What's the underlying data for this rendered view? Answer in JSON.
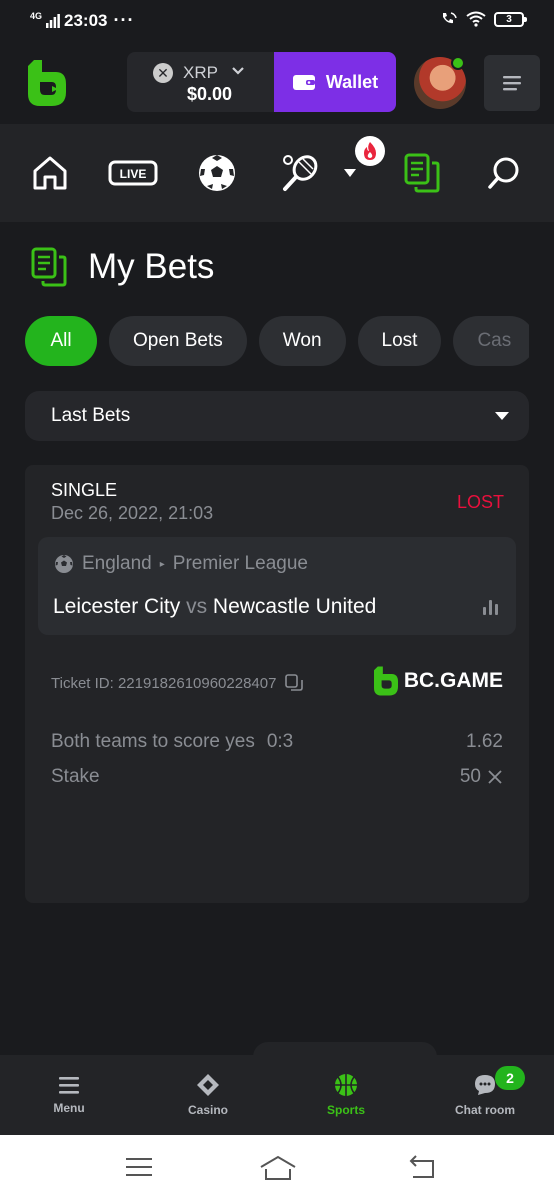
{
  "status_bar": {
    "network": "4G",
    "time": "23:03",
    "dots": "···",
    "battery": "3"
  },
  "header": {
    "currency": "XRP",
    "currency_icon": "x-coin-icon",
    "balance": "$0.00",
    "wallet_label": "Wallet"
  },
  "nav": {
    "icons": [
      "home-icon",
      "live-icon",
      "soccer-ball-icon",
      "tennis-icon",
      "more-dropdown-icon",
      "fire-icon",
      "my-bets-icon",
      "search-icon"
    ],
    "live_label": "LIVE"
  },
  "page": {
    "title": "My Bets"
  },
  "filters": [
    {
      "label": "All",
      "active": true
    },
    {
      "label": "Open Bets"
    },
    {
      "label": "Won"
    },
    {
      "label": "Lost"
    },
    {
      "label": "Cas"
    }
  ],
  "dropdown": {
    "selected": "Last Bets"
  },
  "bet": {
    "type": "SINGLE",
    "date": "Dec 26, 2022, 21:03",
    "status": "LOST",
    "country": "England",
    "league": "Premier League",
    "home": "Leicester City",
    "vs": "vs",
    "away": "Newcastle United",
    "ticket": "Ticket ID: 2219182610960228407",
    "brand": "BC.GAME",
    "selection": "Both teams to score yes",
    "score": "0:3",
    "odds": "1.62",
    "stake_label": "Stake",
    "stake_value": "50"
  },
  "tabbar": [
    {
      "label": "Menu",
      "icon": "menu-icon"
    },
    {
      "label": "Casino",
      "icon": "casino-icon"
    },
    {
      "label": "Sports",
      "icon": "basketball-icon",
      "active": true
    },
    {
      "label": "Chat room",
      "icon": "chat-icon",
      "badge": "2"
    }
  ],
  "colors": {
    "accent": "#23b41d",
    "wallet": "#7d2fe6",
    "lost": "#e9103d",
    "bg": "#1a1b1e"
  }
}
